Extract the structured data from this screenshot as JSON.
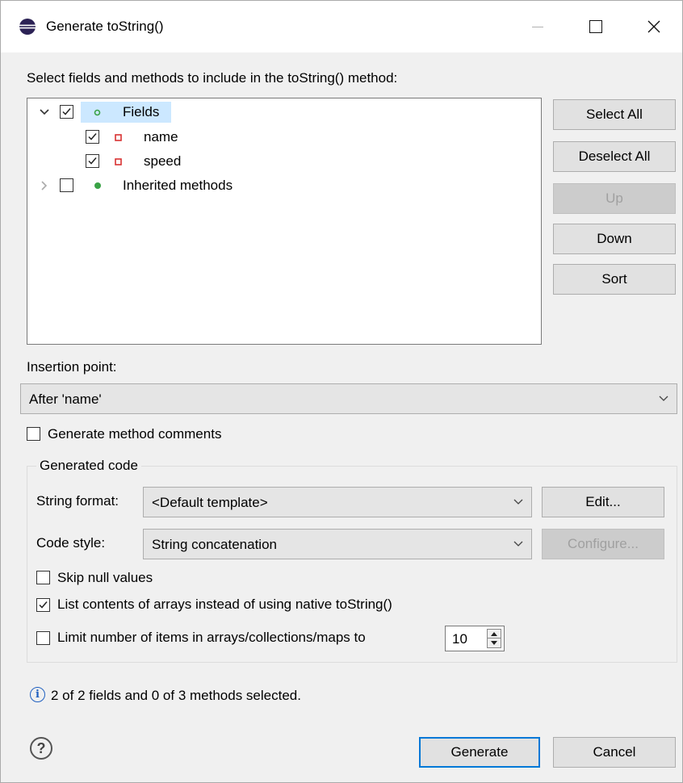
{
  "window": {
    "title": "Generate toString()",
    "controls": {
      "minimize": "minimize",
      "maximize": "maximize",
      "close": "close"
    }
  },
  "selection": {
    "prompt": "Select fields and methods to include in the toString() method:",
    "tree": [
      {
        "label": "Fields",
        "checked": true,
        "expanded": true,
        "icon": "field-group-icon",
        "children": [
          {
            "label": "name",
            "checked": true,
            "icon": "private-field-icon"
          },
          {
            "label": "speed",
            "checked": true,
            "icon": "private-field-icon"
          }
        ]
      },
      {
        "label": "Inherited methods",
        "checked": false,
        "expanded": false,
        "icon": "public-method-icon"
      }
    ]
  },
  "side_buttons": {
    "select_all": "Select All",
    "deselect_all": "Deselect All",
    "up": "Up",
    "down": "Down",
    "sort": "Sort"
  },
  "insertion": {
    "label": "Insertion point:",
    "value": "After 'name'"
  },
  "options": {
    "generate_comments": {
      "label": "Generate method comments",
      "checked": false
    }
  },
  "generated_code": {
    "group_label": "Generated code",
    "string_format_label": "String format:",
    "string_format_value": "<Default template>",
    "edit_button": "Edit...",
    "code_style_label": "Code style:",
    "code_style_value": "String concatenation",
    "configure_button": "Configure...",
    "skip_null": {
      "label": "Skip null values",
      "checked": false
    },
    "list_arrays": {
      "label": "List contents of arrays instead of using native toString()",
      "checked": true
    },
    "limit_items": {
      "label": "Limit number of items in arrays/collections/maps to",
      "checked": false,
      "value": "10"
    }
  },
  "status": "2 of 2 fields and 0 of 3 methods selected.",
  "footer": {
    "generate": "Generate",
    "cancel": "Cancel"
  },
  "colors": {
    "accent": "#0078d7",
    "selection_bg": "#cce8ff",
    "field_icon": "#d93232",
    "method_icon": "#3aa346"
  }
}
